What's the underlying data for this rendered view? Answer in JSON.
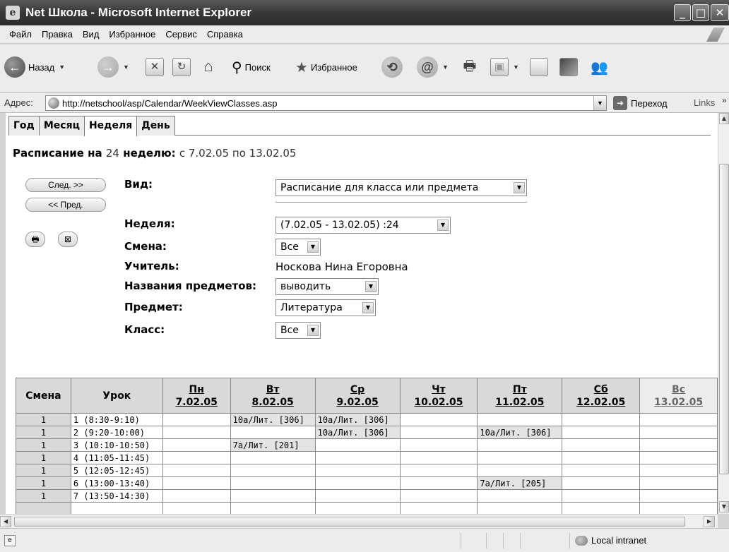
{
  "window": {
    "title": "Net Школа - Microsoft Internet Explorer"
  },
  "menu": [
    "Файл",
    "Правка",
    "Вид",
    "Избранное",
    "Сервис",
    "Справка"
  ],
  "toolbar": {
    "back": "Назад",
    "search": "Поиск",
    "favorites": "Избранное"
  },
  "address": {
    "label": "Адрес:",
    "url": "http://netschool/asp/Calendar/WeekViewClasses.asp",
    "go": "Переход",
    "links": "Links"
  },
  "tabs": [
    "Год",
    "Месяц",
    "Неделя",
    "День"
  ],
  "heading": {
    "prefix": "Расписание на",
    "week": "24",
    "mid": "неделю:",
    "range": "с 7.02.05 по 13.02.05"
  },
  "nav": {
    "next": "След. >>",
    "prev": "<< Пред."
  },
  "form": {
    "view_label": "Вид:",
    "view_value": "Расписание для класса или предмета",
    "week_label": "Неделя:",
    "week_value": "(7.02.05 - 13.02.05) :24",
    "shift_label": "Смена:",
    "shift_value": "Все",
    "teacher_label": "Учитель:",
    "teacher_value": "Носкова Нина Егоровна",
    "subjnames_label": "Названия предметов:",
    "subjnames_value": "выводить",
    "subject_label": "Предмет:",
    "subject_value": "Литература",
    "class_label": "Класс:",
    "class_value": "Все"
  },
  "table": {
    "h_shift": "Смена",
    "h_lesson": "Урок",
    "days": [
      {
        "d": "Пн",
        "date": "7.02.05"
      },
      {
        "d": "Вт",
        "date": "8.02.05"
      },
      {
        "d": "Ср",
        "date": "9.02.05"
      },
      {
        "d": "Чт",
        "date": "10.02.05"
      },
      {
        "d": "Пт",
        "date": "11.02.05"
      },
      {
        "d": "Сб",
        "date": "12.02.05"
      },
      {
        "d": "Вс",
        "date": "13.02.05"
      }
    ],
    "rows": [
      {
        "shift": "1",
        "lesson": "1 (8:30-9:10)",
        "cells": [
          "",
          "10а/Лит. [306]",
          "10а/Лит. [306]",
          "",
          "",
          "",
          ""
        ]
      },
      {
        "shift": "1",
        "lesson": "2 (9:20-10:00)",
        "cells": [
          "",
          "",
          "10а/Лит. [306]",
          "",
          "10а/Лит. [306]",
          "",
          ""
        ]
      },
      {
        "shift": "1",
        "lesson": "3 (10:10-10:50)",
        "cells": [
          "",
          "7а/Лит. [201]",
          "",
          "",
          "",
          "",
          ""
        ]
      },
      {
        "shift": "1",
        "lesson": "4 (11:05-11:45)",
        "cells": [
          "",
          "",
          "",
          "",
          "",
          "",
          ""
        ]
      },
      {
        "shift": "1",
        "lesson": "5 (12:05-12:45)",
        "cells": [
          "",
          "",
          "",
          "",
          "",
          "",
          ""
        ]
      },
      {
        "shift": "1",
        "lesson": "6 (13:00-13:40)",
        "cells": [
          "",
          "",
          "",
          "",
          "7а/Лит. [205]",
          "",
          ""
        ]
      },
      {
        "shift": "1",
        "lesson": "7 (13:50-14:30)",
        "cells": [
          "",
          "",
          "",
          "",
          "",
          "",
          ""
        ]
      }
    ]
  },
  "status": {
    "zone": "Local intranet"
  }
}
